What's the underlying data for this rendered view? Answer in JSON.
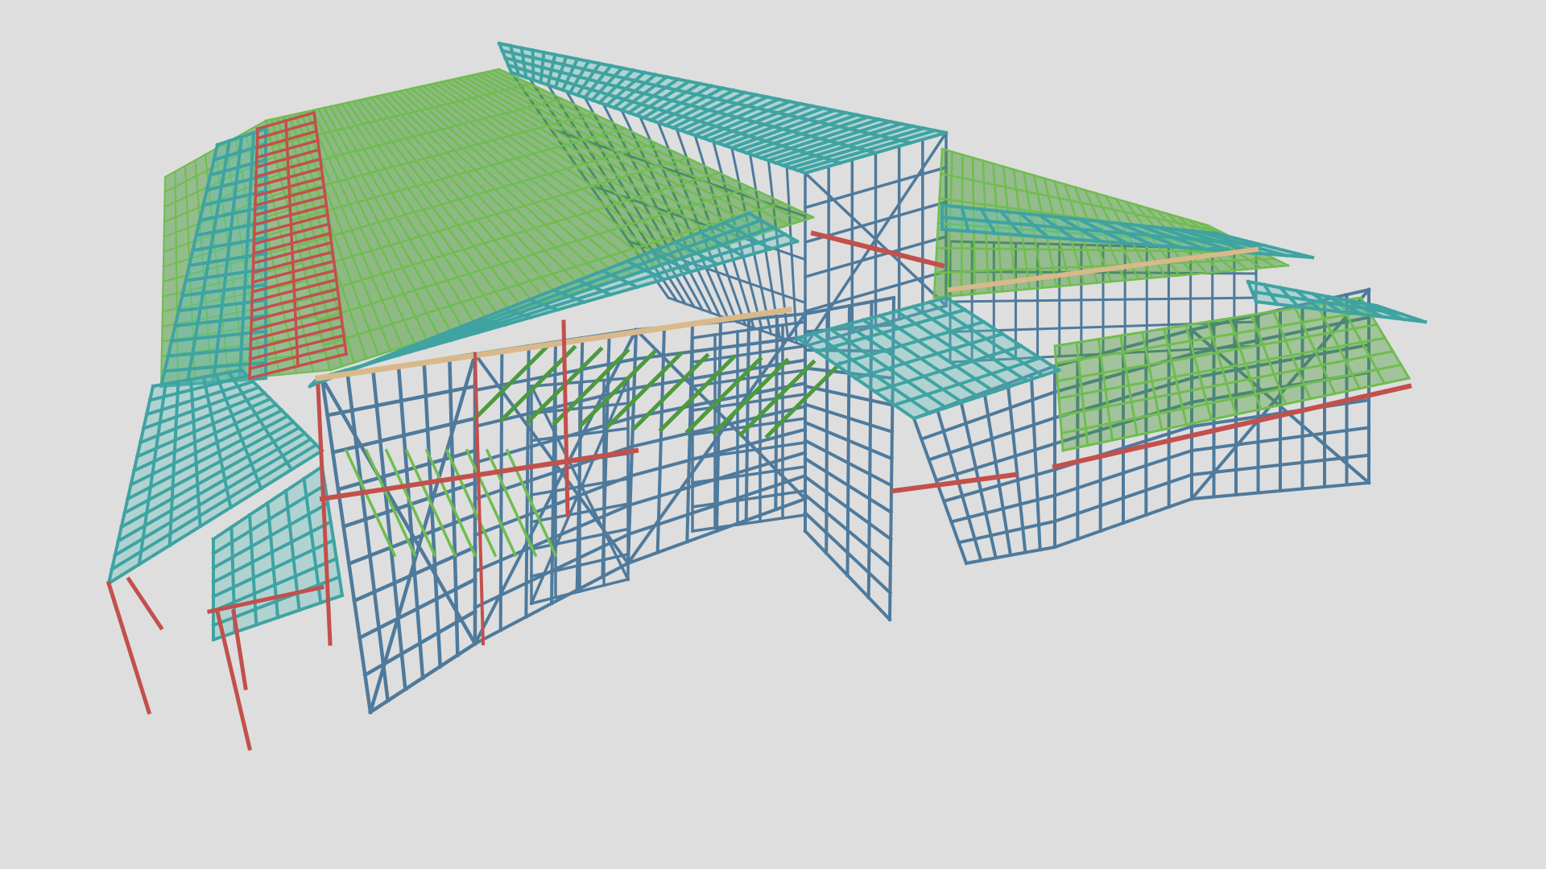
{
  "scene": {
    "background": "#dedede",
    "colors": {
      "wall_frame": "#4e7a9c",
      "wall_frame_dark": "#3d6686",
      "truss": "#4c9a3c",
      "truss_light": "#6fbd4f",
      "roof_purlin": "#5bc1bd",
      "roof_purlin_dark": "#3fa3a2",
      "beam": "#c2504c",
      "top_plate": "#d9b98a"
    },
    "components": [
      "wall-frames",
      "roof-trusses",
      "roof-battens",
      "beams",
      "top-plates",
      "posts"
    ]
  }
}
